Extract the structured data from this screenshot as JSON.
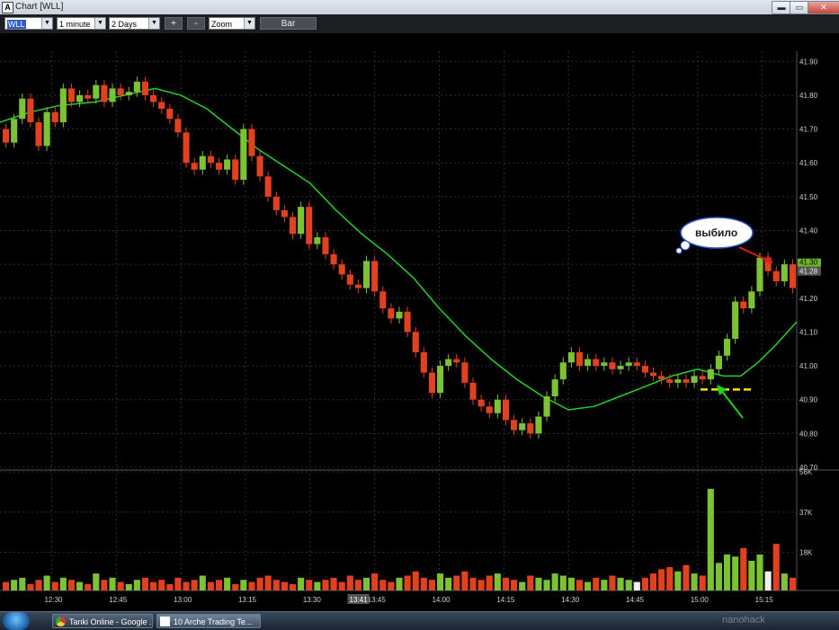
{
  "window": {
    "title": "Chart [WLL]",
    "min_label": "▬",
    "max_label": "▭",
    "close_label": "✕",
    "app_icon": "A"
  },
  "toolbar": {
    "symbol": "WLL",
    "interval": "1 minute",
    "range": "2 Days",
    "zoom_in": "+",
    "zoom_out": "-",
    "zoom_mode": "Zoom",
    "chart_type": "Bar"
  },
  "taskbar": {
    "items": [
      {
        "label": "Tanki Online - Google ...",
        "icon": "chrome-icon"
      },
      {
        "label": "10 Arche Trading Te...",
        "icon": "arche-icon"
      }
    ],
    "tray_text": "nanohack"
  },
  "chart_data": {
    "type": "candlestick",
    "symbol": "WLL",
    "price_ylim": [
      40.7,
      41.93
    ],
    "price_ticks": [
      "41.90",
      "41.80",
      "41.70",
      "41.60",
      "41.50",
      "41.40",
      "41.30",
      "41.20",
      "41.10",
      "41.00",
      "40.90",
      "40.80",
      "40.70"
    ],
    "volume_ticks": [
      "56K",
      "37K",
      "18K"
    ],
    "volume_ylim": [
      0,
      56000
    ],
    "time_ticks": [
      "12:30",
      "12:45",
      "13:00",
      "13:15",
      "13:30",
      "13:45",
      "14:00",
      "14:15",
      "14:30",
      "14:45",
      "15:00",
      "15:15"
    ],
    "cursor_time": "13:41",
    "last_price": "41.28",
    "ask_label": "41.30",
    "colors": {
      "up": "#7bc234",
      "down": "#e2411f",
      "ma": "#22d42a",
      "grid": "#303030",
      "volume_spike": "#f0f0f0"
    },
    "moving_average": [
      [
        "12:18",
        41.72
      ],
      [
        "12:25",
        41.75
      ],
      [
        "12:32",
        41.77
      ],
      [
        "12:40",
        41.78
      ],
      [
        "12:47",
        41.8
      ],
      [
        "12:54",
        41.82
      ],
      [
        "13:00",
        41.8
      ],
      [
        "13:06",
        41.76
      ],
      [
        "13:12",
        41.7
      ],
      [
        "13:18",
        41.64
      ],
      [
        "13:24",
        41.59
      ],
      [
        "13:30",
        41.54
      ],
      [
        "13:36",
        41.46
      ],
      [
        "13:42",
        41.39
      ],
      [
        "13:48",
        41.33
      ],
      [
        "13:54",
        41.26
      ],
      [
        "14:00",
        41.17
      ],
      [
        "14:06",
        41.09
      ],
      [
        "14:12",
        41.02
      ],
      [
        "14:18",
        40.96
      ],
      [
        "14:24",
        40.91
      ],
      [
        "14:30",
        40.87
      ],
      [
        "14:36",
        40.88
      ],
      [
        "14:42",
        40.91
      ],
      [
        "14:48",
        40.94
      ],
      [
        "14:54",
        40.97
      ],
      [
        "15:00",
        40.99
      ],
      [
        "15:06",
        40.97
      ],
      [
        "15:10",
        40.97
      ],
      [
        "15:14",
        41.01
      ],
      [
        "15:18",
        41.06
      ],
      [
        "15:23",
        41.13
      ]
    ],
    "candles": [
      [
        41.7,
        41.66
      ],
      [
        41.66,
        41.73
      ],
      [
        41.73,
        41.79
      ],
      [
        41.79,
        41.72
      ],
      [
        41.72,
        41.65
      ],
      [
        41.65,
        41.75
      ],
      [
        41.75,
        41.72
      ],
      [
        41.72,
        41.82
      ],
      [
        41.82,
        41.78
      ],
      [
        41.78,
        41.8
      ],
      [
        41.8,
        41.79
      ],
      [
        41.79,
        41.83
      ],
      [
        41.83,
        41.78
      ],
      [
        41.78,
        41.82
      ],
      [
        41.82,
        41.8
      ],
      [
        41.8,
        41.81
      ],
      [
        41.81,
        41.84
      ],
      [
        41.84,
        41.8
      ],
      [
        41.8,
        41.78
      ],
      [
        41.78,
        41.76
      ],
      [
        41.76,
        41.73
      ],
      [
        41.73,
        41.69
      ],
      [
        41.69,
        41.6
      ],
      [
        41.6,
        41.58
      ],
      [
        41.58,
        41.62
      ],
      [
        41.62,
        41.6
      ],
      [
        41.6,
        41.58
      ],
      [
        41.58,
        41.61
      ],
      [
        41.61,
        41.55
      ],
      [
        41.55,
        41.7
      ],
      [
        41.7,
        41.62
      ],
      [
        41.62,
        41.56
      ],
      [
        41.56,
        41.5
      ],
      [
        41.5,
        41.46
      ],
      [
        41.46,
        41.44
      ],
      [
        41.44,
        41.39
      ],
      [
        41.39,
        41.47
      ],
      [
        41.47,
        41.36
      ],
      [
        41.36,
        41.38
      ],
      [
        41.38,
        41.33
      ],
      [
        41.33,
        41.3
      ],
      [
        41.3,
        41.27
      ],
      [
        41.27,
        41.24
      ],
      [
        41.24,
        41.23
      ],
      [
        41.23,
        41.31
      ],
      [
        41.31,
        41.22
      ],
      [
        41.22,
        41.17
      ],
      [
        41.17,
        41.14
      ],
      [
        41.14,
        41.16
      ],
      [
        41.16,
        41.1
      ],
      [
        41.1,
        41.04
      ],
      [
        41.04,
        40.98
      ],
      [
        40.98,
        40.92
      ],
      [
        40.92,
        41.0
      ],
      [
        41.0,
        41.02
      ],
      [
        41.02,
        41.01
      ],
      [
        41.01,
        40.95
      ],
      [
        40.95,
        40.9
      ],
      [
        40.9,
        40.88
      ],
      [
        40.88,
        40.86
      ],
      [
        40.86,
        40.9
      ],
      [
        40.9,
        40.84
      ],
      [
        40.84,
        40.81
      ],
      [
        40.81,
        40.83
      ],
      [
        40.83,
        40.8
      ],
      [
        40.8,
        40.85
      ],
      [
        40.85,
        40.91
      ],
      [
        40.91,
        40.96
      ],
      [
        40.96,
        41.01
      ],
      [
        41.01,
        41.04
      ],
      [
        41.04,
        41.0
      ],
      [
        41.0,
        41.02
      ],
      [
        41.02,
        41.0
      ],
      [
        41.0,
        41.01
      ],
      [
        41.01,
        40.99
      ],
      [
        40.99,
        41.0
      ],
      [
        41.0,
        41.01
      ],
      [
        41.01,
        41.0
      ],
      [
        41.0,
        40.98
      ],
      [
        40.98,
        40.97
      ],
      [
        40.97,
        40.96
      ],
      [
        40.96,
        40.95
      ],
      [
        40.95,
        40.96
      ],
      [
        40.96,
        40.95
      ],
      [
        40.95,
        40.97
      ],
      [
        40.97,
        40.96
      ],
      [
        40.96,
        40.99
      ],
      [
        40.99,
        41.03
      ],
      [
        41.03,
        41.08
      ],
      [
        41.08,
        41.19
      ],
      [
        41.19,
        41.17
      ],
      [
        41.17,
        41.22
      ],
      [
        41.22,
        41.32
      ],
      [
        41.32,
        41.28
      ],
      [
        41.28,
        41.25
      ],
      [
        41.25,
        41.3
      ],
      [
        41.3,
        41.23
      ]
    ],
    "volumes": [
      4,
      5,
      6,
      3,
      5,
      7,
      4,
      6,
      5,
      4,
      3,
      8,
      5,
      6,
      4,
      3,
      5,
      6,
      4,
      5,
      3,
      6,
      4,
      5,
      7,
      4,
      5,
      6,
      3,
      5,
      4,
      6,
      7,
      5,
      4,
      3,
      6,
      5,
      4,
      5,
      6,
      4,
      7,
      5,
      6,
      8,
      5,
      4,
      6,
      7,
      9,
      6,
      5,
      8,
      6,
      7,
      9,
      6,
      5,
      7,
      8,
      6,
      5,
      4,
      7,
      6,
      5,
      8,
      7,
      6,
      5,
      4,
      6,
      5,
      7,
      6,
      5,
      4,
      6,
      8,
      10,
      11,
      9,
      12,
      8,
      7,
      48,
      13,
      17,
      16,
      20,
      14,
      17,
      9,
      22,
      8,
      6
    ],
    "volume_spikes": {
      "77": true,
      "93": true
    },
    "annotations": {
      "callout_text": "выбило",
      "support_line_price": 40.93
    }
  }
}
